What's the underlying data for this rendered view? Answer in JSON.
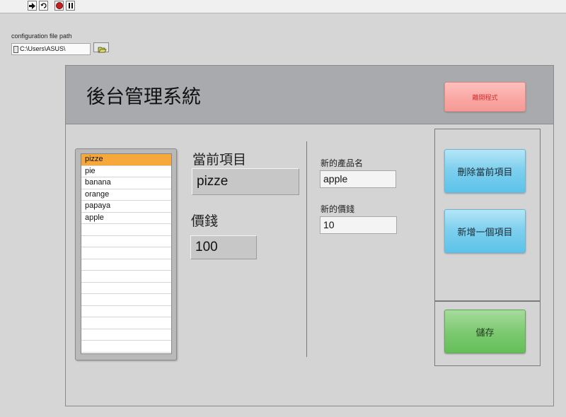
{
  "toolbar": {
    "buttons": [
      {
        "icon": "run-arrow-icon"
      },
      {
        "icon": "run-continuously-icon"
      },
      {
        "icon": "abort-stop-icon"
      },
      {
        "icon": "pause-icon"
      }
    ]
  },
  "config": {
    "label": "configuration file path",
    "value": "C:\\Users\\ASUS\\",
    "browse_icon": "folder-open-icon"
  },
  "header": {
    "title": "後台管理系統",
    "close_label": "離開程式"
  },
  "product_list": {
    "items": [
      "pizze",
      "pie",
      "banana",
      "orange",
      "papaya",
      "apple"
    ],
    "selected": "pizze"
  },
  "current": {
    "item_label": "當前項目",
    "item_value": "pizze",
    "price_label": "價錢",
    "price_value": "100"
  },
  "new_item": {
    "name_label": "新的產品名",
    "name_value": "apple",
    "price_label": "新的價錢",
    "price_value": "10"
  },
  "buttons": {
    "delete_label": "刪除當前項目",
    "add_label": "新增一個項目",
    "save_label": "儲存"
  },
  "colors": {
    "selected_row": "#f6a83a",
    "close_button": "#f9a6a2",
    "action_button": "#7fd0ee",
    "save_button": "#7bc86f"
  }
}
